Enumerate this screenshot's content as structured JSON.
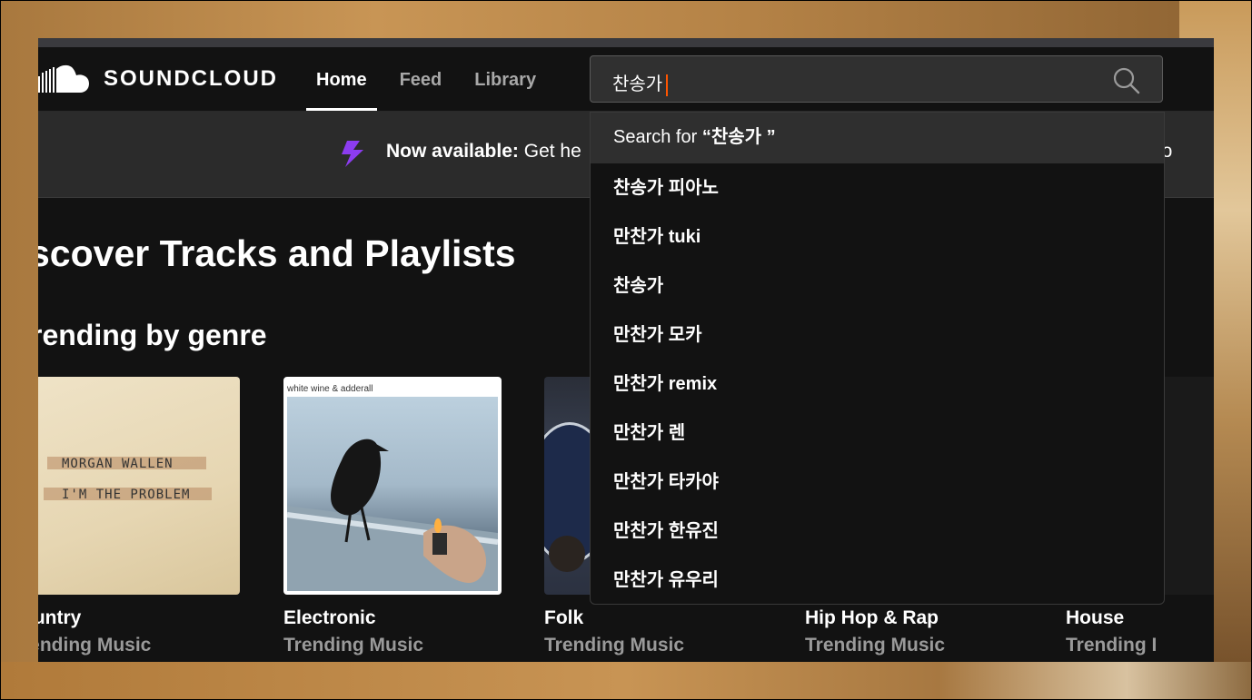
{
  "app": {
    "logo_text": "SOUNDCLOUD",
    "nav": {
      "home": "Home",
      "feed": "Feed",
      "library": "Library"
    },
    "search": {
      "value": "찬송가",
      "icon": "search-icon"
    }
  },
  "banner": {
    "bold": "Now available:",
    "text": "Get he",
    "right_text": "t Pro",
    "icon": "lightning-icon",
    "icon_color": "#8c3cf0"
  },
  "main": {
    "heading": "scover Tracks and Playlists",
    "subheading": "rending by genre",
    "cards": [
      {
        "title": "ountry",
        "subtitle": "rending Music",
        "art_caption_1": "MORGAN WALLEN",
        "art_caption_2": "I'M THE PROBLEM"
      },
      {
        "title": "Electronic",
        "subtitle": "Trending Music",
        "art_caption": "white wine & adderall"
      },
      {
        "title": "Folk",
        "subtitle": "Trending Music"
      },
      {
        "title": "Hip Hop & Rap",
        "subtitle": "Trending Music"
      },
      {
        "title": "House",
        "subtitle": "Trending I"
      }
    ]
  },
  "dropdown": {
    "search_for_prefix": "Search for ",
    "search_for_query": "“찬송가 ”",
    "suggestions": [
      "찬송가 피아노",
      "만찬가 tuki",
      "찬송가",
      "만찬가 모카",
      "만찬가 remix",
      "만찬가 렌",
      "만찬가 타카야",
      "만찬가 한유진",
      "만찬가 유우리"
    ]
  },
  "colors": {
    "accent": "#ff5500",
    "background": "#121212",
    "banner_bg": "#2b2b2b"
  }
}
